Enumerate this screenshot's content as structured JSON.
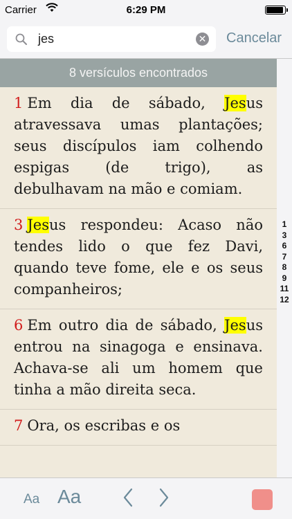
{
  "status": {
    "carrier": "Carrier",
    "time": "6:29 PM",
    "battery_level": 0.95
  },
  "search": {
    "query": "jes",
    "cancel_label": "Cancelar"
  },
  "results": {
    "banner": "8 versículos encontrados",
    "index": [
      "1",
      "3",
      "6",
      "7",
      "8",
      "9",
      "11",
      "12"
    ]
  },
  "verses": [
    {
      "num": "1",
      "pre": "Em dia de sábado, ",
      "hl": "Jes",
      "post": "us atravessava umas plantações; seus discípulos iam colhendo espigas (de trigo), as debulhavam na mão e comiam."
    },
    {
      "num": "3",
      "pre": "",
      "hl": "Jes",
      "post": "us respondeu: Acaso não tendes lido o que fez Davi, quando teve fome, ele e os seus companheiros;"
    },
    {
      "num": "6",
      "pre": "Em outro dia de sábado, ",
      "hl": "Jes",
      "post": "us entrou na sinagoga e ensinava. Achava-se ali um homem que tinha a mão direita seca."
    },
    {
      "num": "7",
      "pre": "Ora, os escribas e os",
      "hl": "",
      "post": ""
    }
  ],
  "toolbar": {
    "font_small": "Aa",
    "font_large": "Aa"
  },
  "colors": {
    "highlight": "#ffff00",
    "verse_number": "#d11c1c",
    "accent": "#6b8a9a"
  }
}
